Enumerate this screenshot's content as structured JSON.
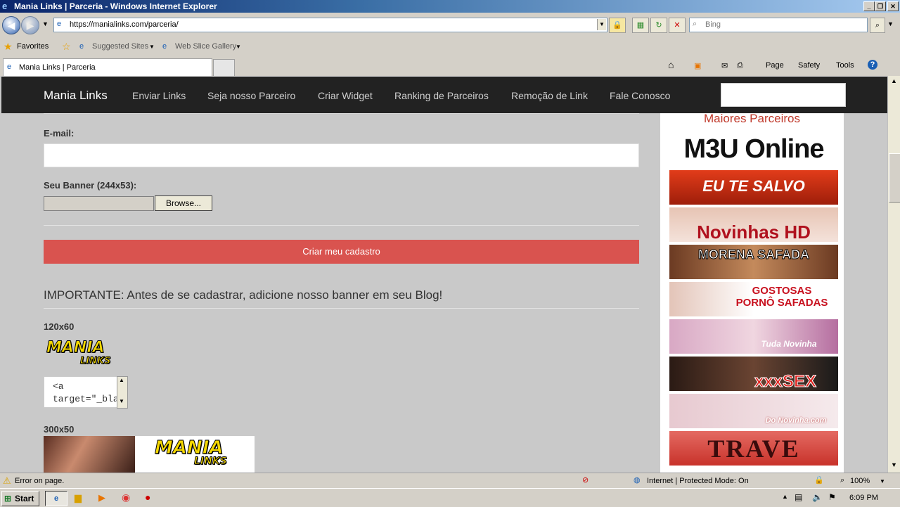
{
  "window": {
    "title": "Mania Links | Parceria - Windows Internet Explorer"
  },
  "nav": {
    "url": "https://manialinks.com/parceria/",
    "search_placeholder": "Bing"
  },
  "favorites": {
    "favorites_label": "Favorites",
    "suggested_sites": "Suggested Sites",
    "web_slice_gallery": "Web Slice Gallery"
  },
  "tab": {
    "label": "Mania Links | Parceria"
  },
  "command_bar": {
    "page": "Page",
    "safety": "Safety",
    "tools": "Tools"
  },
  "site": {
    "brand": "Mania Links",
    "nav_links": [
      "Enviar Links",
      "Seja nosso Parceiro",
      "Criar Widget",
      "Ranking de Parceiros",
      "Remoção de Link",
      "Fale Conosco"
    ]
  },
  "form": {
    "email_label": "E-mail:",
    "banner_label": "Seu Banner (244x53):",
    "browse_label": "Browse...",
    "submit_label": "Criar meu cadastro",
    "important_text": "IMPORTANTE: Antes de se cadastrar, adicione nosso banner em seu Blog!",
    "size_120": "120x60",
    "size_300": "300x50",
    "code_line1": "<a",
    "code_line2": "target=\"_bla"
  },
  "banner_logo": {
    "line1": "MANIA",
    "line2": "LINKS"
  },
  "sidebar": {
    "heading": "Maiores Parceiros",
    "ads": [
      "M3U Online",
      "EU TE SALVO",
      "Novinhas HD",
      "MORENA SAFADA",
      "GOSTOSAS PORNÔ SAFADAS",
      "Tuda Novinha",
      "xxxSEX",
      "Do Novinha.com",
      "TRAVE"
    ]
  },
  "status": {
    "message": "Error on page.",
    "zone": "Internet | Protected Mode: On",
    "zoom": "100%"
  },
  "taskbar": {
    "start": "Start",
    "clock": "6:09 PM"
  },
  "colors": {
    "navbar": "#222222",
    "submit": "#d9534f",
    "sidebar_heading": "#c0392b",
    "page_bg": "#c9c9c9"
  }
}
